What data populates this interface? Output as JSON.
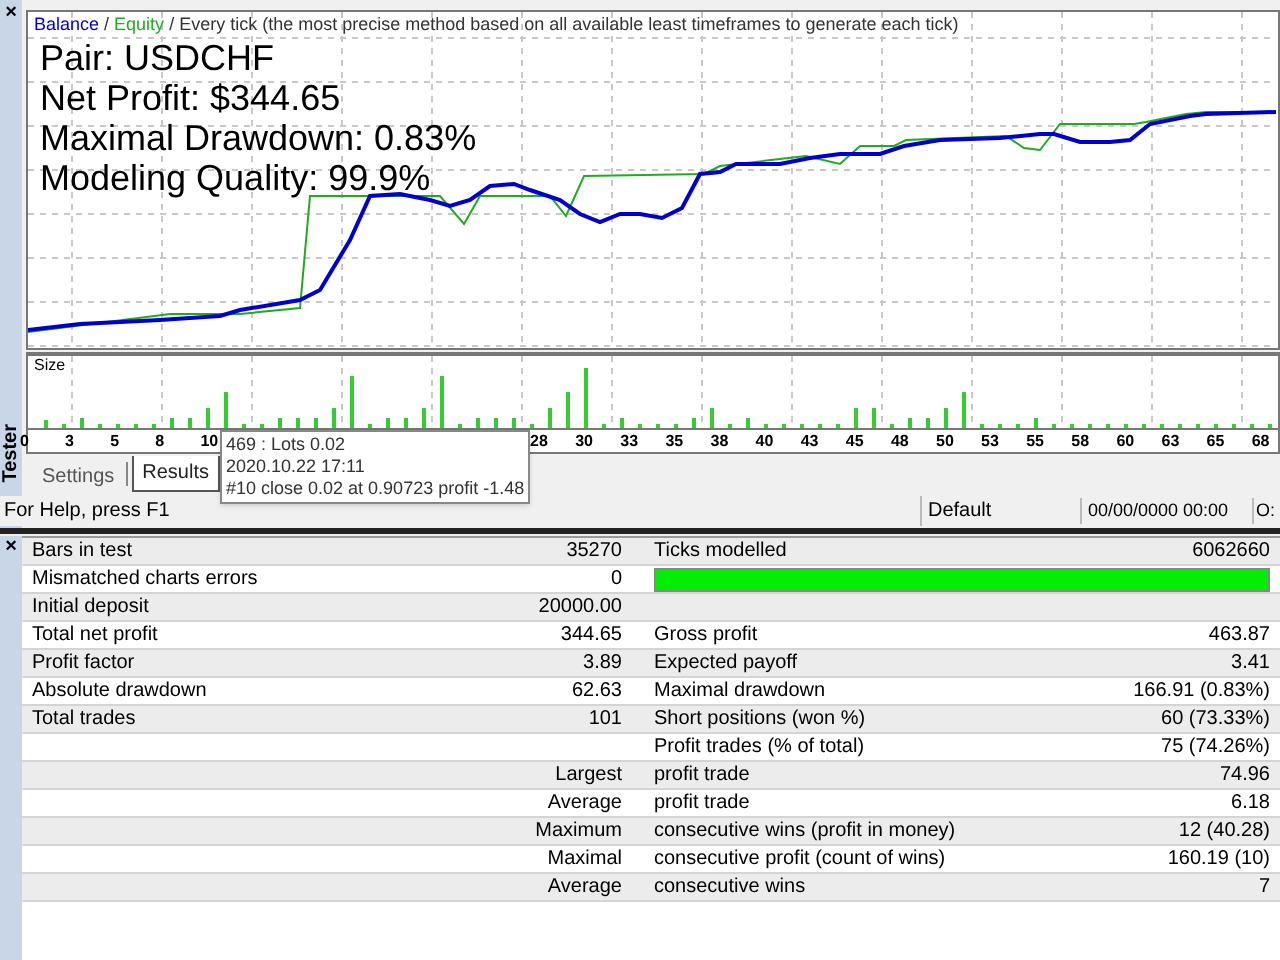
{
  "chart": {
    "legend": [
      {
        "label": "Balance",
        "color": "#0000cc"
      },
      {
        "label": "Equity",
        "color": "#22aa22"
      }
    ],
    "separator": " / ",
    "description": " / Every tick (the most precise method based on all available least timeframes to generate each tick)",
    "overlay": [
      "Pair: USDCHF",
      "Net Profit: $344.65",
      "Maximal Drawdown: 0.83%",
      "Modeling Quality: 99.9%"
    ],
    "size_label": "Size",
    "ticks": [
      "0",
      "3",
      "5",
      "8",
      "10",
      "28",
      "30",
      "33",
      "35",
      "38",
      "40",
      "43",
      "45",
      "48",
      "50",
      "53",
      "55",
      "58",
      "60",
      "63",
      "65",
      "68"
    ]
  },
  "tooltip": [
    "469 : Lots 0.02",
    "2020.10.22 17:11",
    "#10 close 0.02 at 0.90723 profit -1.48"
  ],
  "side_panel": {
    "title": "Tester",
    "close": "×"
  },
  "tabs": [
    {
      "label": "Settings",
      "selected": false
    },
    {
      "label": "Results",
      "selected": true
    }
  ],
  "status_bar": {
    "help": "For Help, press F1",
    "profile": "Default",
    "time": "00/00/0000 00:00",
    "extra": "O:"
  },
  "report": {
    "close": "×",
    "rows": [
      {
        "kind": "stat",
        "label": "Bars in test",
        "value": "35270",
        "label_2": "Ticks modelled",
        "value_2": "6062660"
      },
      {
        "kind": "stat",
        "label": "Mismatched charts errors",
        "value": "0",
        "level": 1
      },
      {
        "kind": "stat",
        "label": "Initial deposit",
        "value": "20000.00"
      },
      {
        "kind": "stat",
        "label": "Total net profit",
        "value": "344.65",
        "label_2": "Gross profit",
        "value_2": "463.87"
      },
      {
        "kind": "stat",
        "label": "Profit factor",
        "value": "3.89",
        "label_2": "Expected payoff",
        "value_2": "3.41"
      },
      {
        "kind": "stat",
        "label": "Absolute drawdown",
        "value": "62.63",
        "label_2": "Maximal drawdown",
        "value_2": "166.91 (0.83%)"
      },
      {
        "kind": "stat",
        "label": "Total trades",
        "value": "101",
        "label_2": "Short positions (won %)",
        "value_2": "60 (73.33%)"
      },
      {
        "kind": "stat",
        "label_2": "Profit trades (% of total)",
        "value_2": "75 (74.26%)"
      },
      {
        "kind": "sub",
        "label": "Largest",
        "label_2": "profit trade",
        "value_2": "74.96"
      },
      {
        "kind": "sub",
        "label": "Average",
        "label_2": "profit trade",
        "value_2": "6.18"
      },
      {
        "kind": "sub",
        "label": "Maximum",
        "label_2": "consecutive wins (profit in money)",
        "value_2": "12 (40.28)"
      },
      {
        "kind": "sub",
        "label": "Maximal",
        "label_2": "consecutive profit (count of wins)",
        "value_2": "160.19 (10)"
      },
      {
        "kind": "sub",
        "label": "Average",
        "label_2": "consecutive wins",
        "value_2": "7"
      }
    ]
  }
}
